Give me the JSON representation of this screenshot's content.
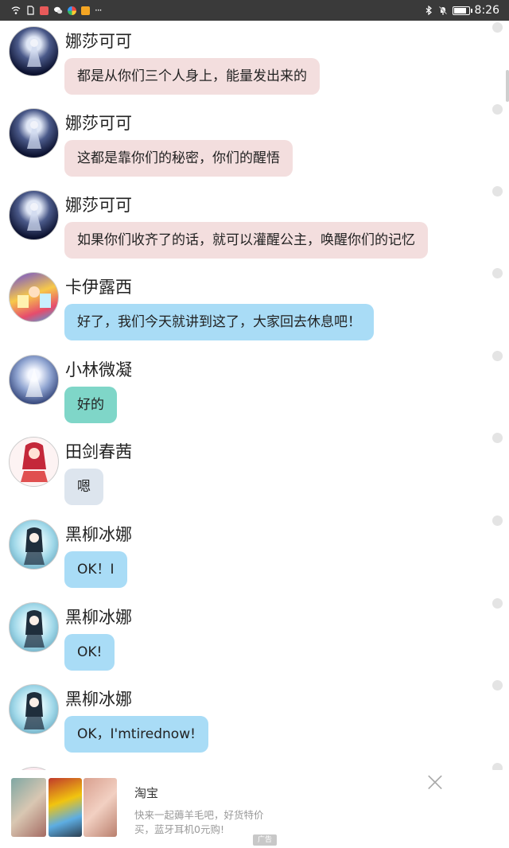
{
  "status_bar": {
    "time": "8:26",
    "more_glyph": "···",
    "left_icons": [
      "wifi-icon",
      "sim-icon",
      "app-red-icon",
      "wechat-icon",
      "app-multicolor-icon",
      "app-orange-icon"
    ],
    "right_icons": [
      "bluetooth-icon",
      "bell-muted-icon",
      "battery-icon"
    ]
  },
  "messages": [
    {
      "username": "娜莎可可",
      "text": "都是从你们三个人身上，能量发出来的",
      "bubble_color": "#f3dede",
      "avatar": "avatar-dark-girl"
    },
    {
      "username": "娜莎可可",
      "text": "这都是靠你们的秘密，你们的醒悟",
      "bubble_color": "#f3dede",
      "avatar": "avatar-dark-girl"
    },
    {
      "username": "娜莎可可",
      "text": "如果你们收齐了的话，就可以灌醒公主，唤醒你们的记忆",
      "bubble_color": "#f3dede",
      "avatar": "avatar-dark-girl"
    },
    {
      "username": "卡伊露西",
      "text": "好了，我们今天就讲到这了，大家回去休息吧！",
      "bubble_color": "#a9dcf6",
      "avatar": "avatar-game-characters"
    },
    {
      "username": "小林微凝",
      "text": "好的",
      "bubble_color": "#7fd6c8",
      "avatar": "avatar-blue-girl"
    },
    {
      "username": "田剑春茜",
      "text": "嗯",
      "bubble_color": "#dde5ee",
      "avatar": "avatar-red-girl"
    },
    {
      "username": "黑柳冰娜",
      "text": "OK！I",
      "bubble_color": "#a9dcf6",
      "avatar": "avatar-ice-girl"
    },
    {
      "username": "黑柳冰娜",
      "text": "OK!",
      "bubble_color": "#a9dcf6",
      "avatar": "avatar-ice-girl"
    },
    {
      "username": "黑柳冰娜",
      "text": "OK，I'mtirednow!",
      "bubble_color": "#a9dcf6",
      "avatar": "avatar-ice-girl"
    }
  ],
  "ad": {
    "title": "淘宝",
    "description": "快来一起薅羊毛吧，好货特价买，蓝牙耳机0元购!",
    "badge": "广告",
    "close_glyph": "×"
  }
}
